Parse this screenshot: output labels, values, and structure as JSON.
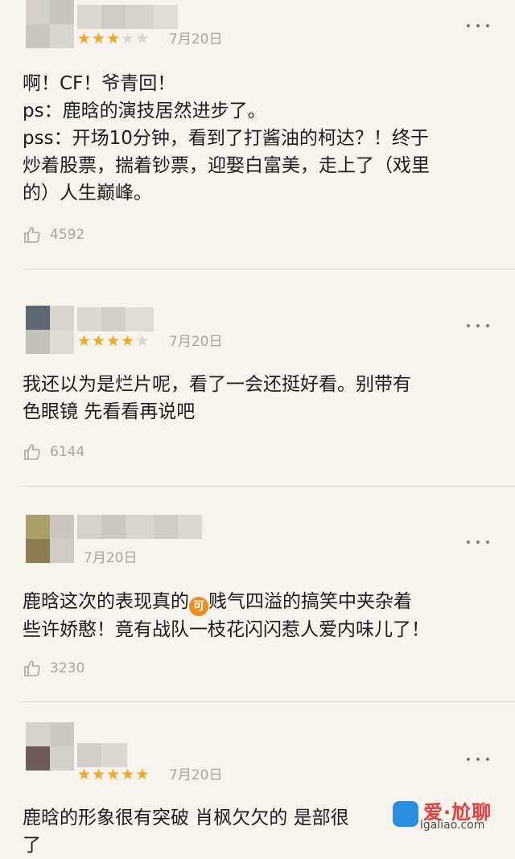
{
  "comments": [
    {
      "stars": 3,
      "date": "7月20日",
      "lines": [
        "啊！CF！爷青回！",
        "ps：鹿晗的演技居然进步了。",
        "pss：开场10分钟，看到了打酱油的柯达？！终于",
        "炒着股票，揣着钞票，迎娶白富美，走上了（戏里",
        "的）人生巅峰。"
      ],
      "likes": "4592"
    },
    {
      "stars": 4,
      "date": "7月20日",
      "lines": [
        "我还以为是烂片呢，看了一会还挺好看。别带有",
        "色眼镜  先看看再说吧"
      ],
      "likes": "6144"
    },
    {
      "stars": 0,
      "date": "7月20日",
      "lines_pre": "鹿晗这次的表现真的",
      "emoji": "可",
      "lines_post": "贱气四溢的搞笑中夹杂着",
      "line2": "些许娇憨！竟有战队一枝花闪闪惹人爱内味儿了！",
      "likes": "3230"
    },
    {
      "stars": 5,
      "date": "7月20日",
      "lines": [
        "鹿晗的形象很有突破 肖枫欠欠的 是部很",
        "了"
      ]
    }
  ],
  "star_glyph": "★",
  "watermark": {
    "title": "爱·尬聊",
    "url": "lgaliao.com"
  },
  "colors": {
    "star": "#f5a623",
    "background": "#f7f4ee"
  }
}
